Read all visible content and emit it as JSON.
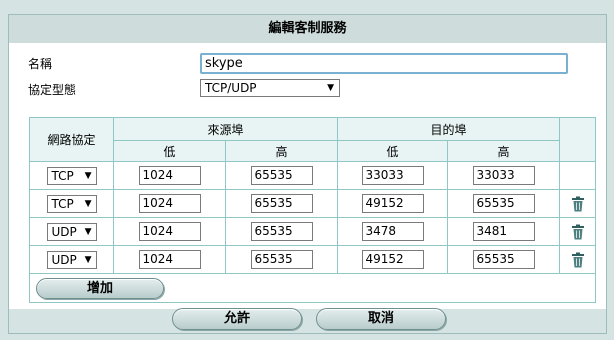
{
  "title": "編輯客制服務",
  "fields": {
    "name_label": "名稱",
    "name_value": "skype",
    "protocol_type_label": "協定型態",
    "protocol_type_value": "TCP/UDP"
  },
  "table": {
    "col_protocol": "網路協定",
    "col_source_port": "來源埠",
    "col_dest_port": "目的埠",
    "low": "低",
    "high": "高",
    "rows": [
      {
        "protocol": "TCP",
        "src_low": "1024",
        "src_high": "65535",
        "dst_low": "33033",
        "dst_high": "33033",
        "deletable": false
      },
      {
        "protocol": "TCP",
        "src_low": "1024",
        "src_high": "65535",
        "dst_low": "49152",
        "dst_high": "65535",
        "deletable": true
      },
      {
        "protocol": "UDP",
        "src_low": "1024",
        "src_high": "65535",
        "dst_low": "3478",
        "dst_high": "3481",
        "deletable": true
      },
      {
        "protocol": "UDP",
        "src_low": "1024",
        "src_high": "65535",
        "dst_low": "49152",
        "dst_high": "65535",
        "deletable": true
      }
    ]
  },
  "buttons": {
    "add": "增加",
    "ok": "允許",
    "cancel": "取消"
  },
  "icons": {
    "dropdown": "chevron-down-icon",
    "delete": "trash-icon"
  }
}
